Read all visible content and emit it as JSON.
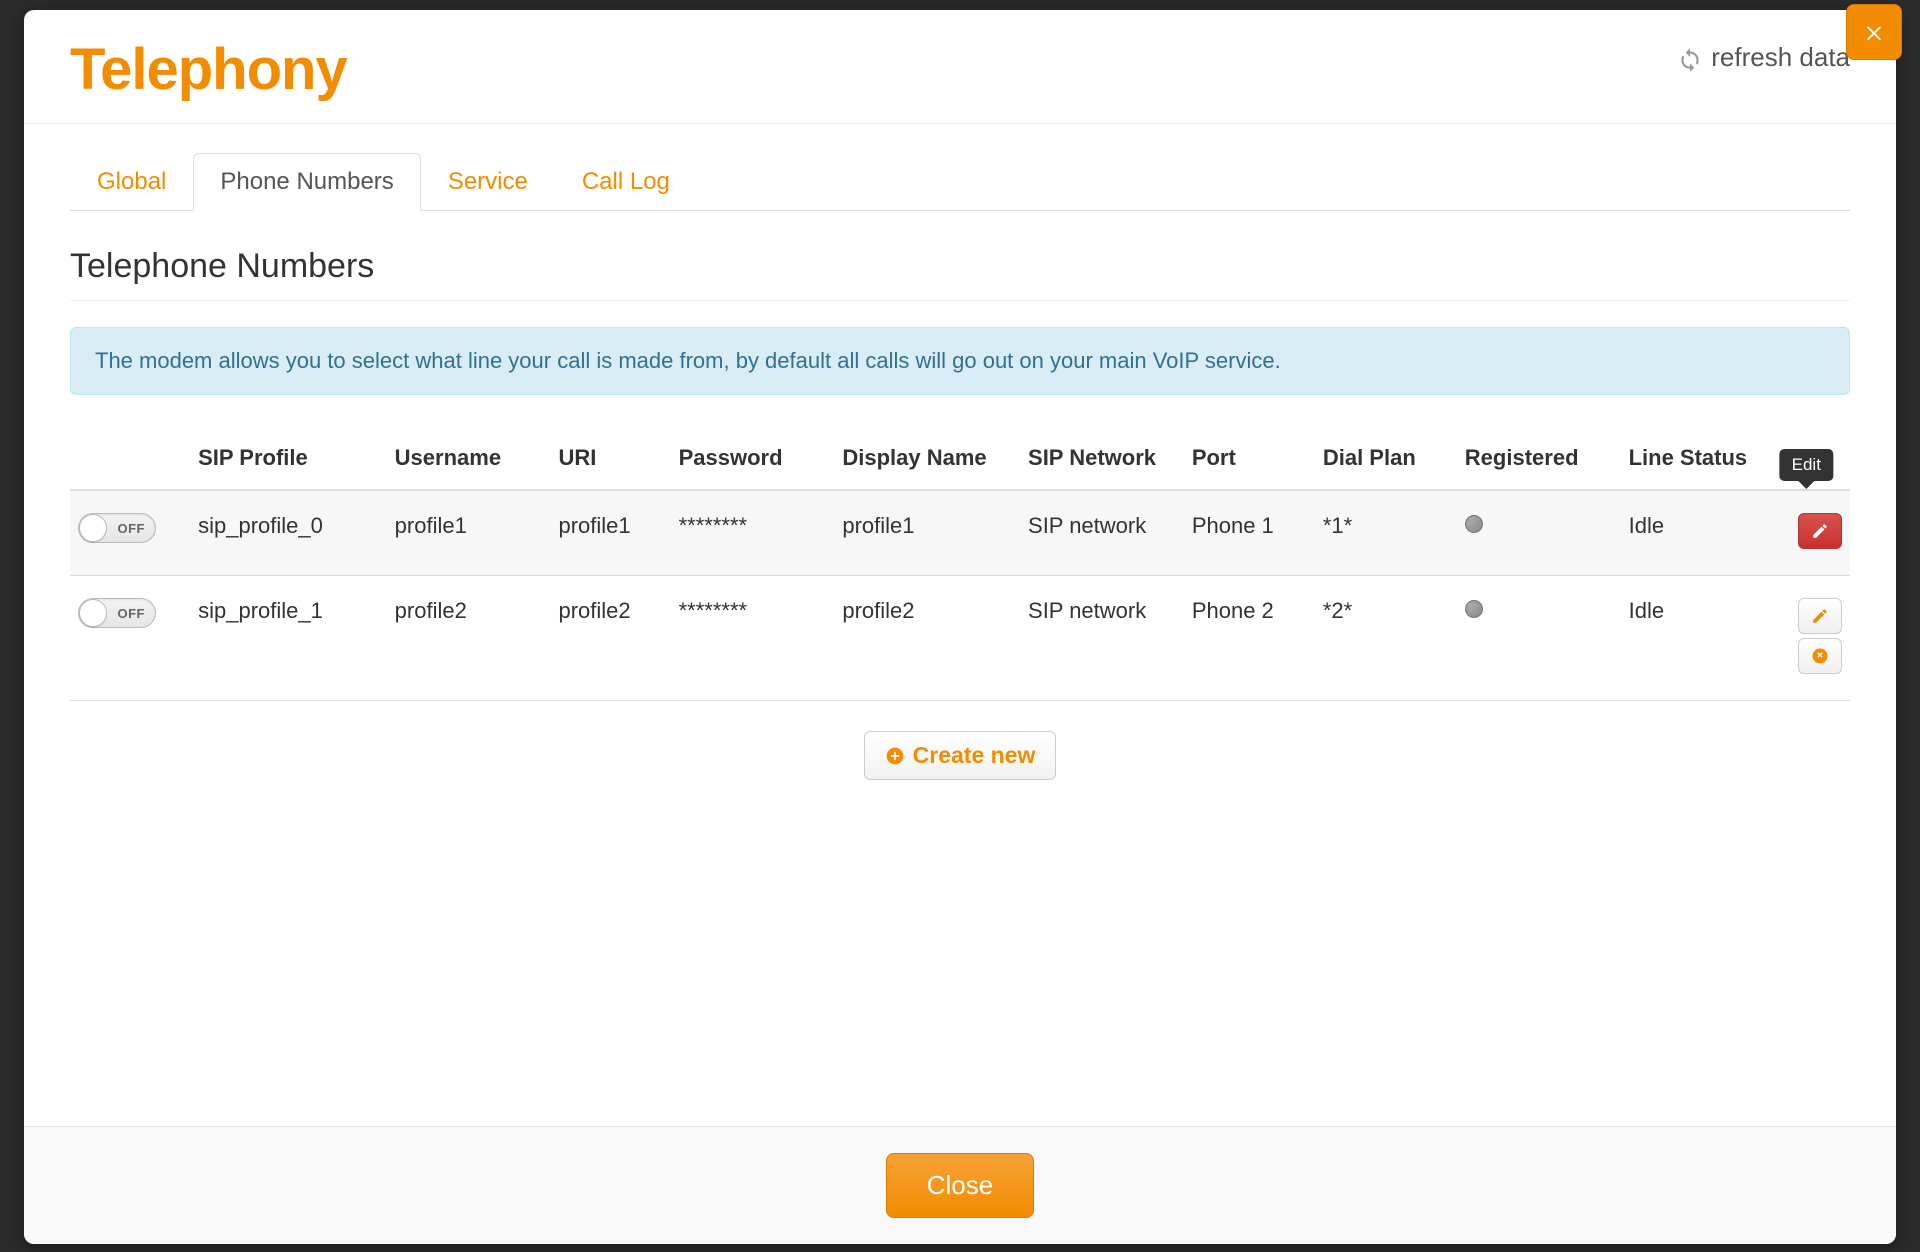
{
  "header": {
    "title": "Telephony",
    "refresh_label": "refresh data"
  },
  "tabs": [
    {
      "label": "Global",
      "active": false
    },
    {
      "label": "Phone Numbers",
      "active": true
    },
    {
      "label": "Service",
      "active": false
    },
    {
      "label": "Call Log",
      "active": false
    }
  ],
  "section_title": "Telephone Numbers",
  "info_text": "The modem allows you to select what line your call is made from, by default all calls will go out on your main VoIP service.",
  "columns": {
    "toggle": "",
    "sip_profile": "SIP Profile",
    "username": "Username",
    "uri": "URI",
    "password": "Password",
    "display_name": "Display Name",
    "sip_network": "SIP Network",
    "port": "Port",
    "dial_plan": "Dial Plan",
    "registered": "Registered",
    "line_status": "Line Status",
    "actions": ""
  },
  "toggle_off_label": "OFF",
  "rows": [
    {
      "enabled": false,
      "sip_profile": "sip_profile_0",
      "username": "profile1",
      "uri": "profile1",
      "password": "********",
      "display_name": "profile1",
      "sip_network": "SIP network",
      "port": "Phone 1",
      "dial_plan": "*1*",
      "registered": false,
      "line_status": "Idle",
      "edit_tooltip": "Edit",
      "show_tooltip": true,
      "show_delete": false
    },
    {
      "enabled": false,
      "sip_profile": "sip_profile_1",
      "username": "profile2",
      "uri": "profile2",
      "password": "********",
      "display_name": "profile2",
      "sip_network": "SIP network",
      "port": "Phone 2",
      "dial_plan": "*2*",
      "registered": false,
      "line_status": "Idle",
      "edit_tooltip": "Edit",
      "show_tooltip": false,
      "show_delete": true
    }
  ],
  "create_label": "Create new",
  "footer": {
    "close_label": "Close"
  }
}
